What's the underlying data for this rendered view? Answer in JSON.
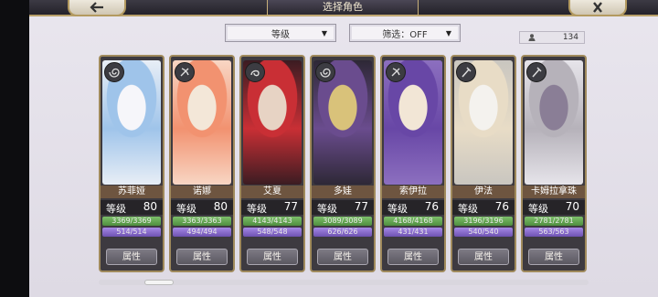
{
  "header": {
    "title": "选择角色",
    "back_icon": "back-arrow-icon",
    "close_icon": "close-icon"
  },
  "filters": {
    "sort_label": "等级",
    "filter_label": "筛选：OFF"
  },
  "counter": {
    "icon": "person-icon",
    "value": "134"
  },
  "level_label": "等级",
  "attr_label": "属性",
  "characters": [
    {
      "name": "苏菲娅",
      "level": "80",
      "hp": "3369/3369",
      "mp": "514/514",
      "hp_pct": 1.0,
      "mp_pct": 1.0,
      "emblem": "spiral-icon",
      "palette": [
        "#e8eef6",
        "#9fc4ea",
        "#f6f6fa"
      ]
    },
    {
      "name": "诺娜",
      "level": "80",
      "hp": "3363/3363",
      "mp": "494/494",
      "hp_pct": 1.0,
      "mp_pct": 1.0,
      "emblem": "bow-icon",
      "palette": [
        "#f8d6c4",
        "#f29270",
        "#f3e7d8"
      ]
    },
    {
      "name": "艾夏",
      "level": "77",
      "hp": "4143/4143",
      "mp": "548/548",
      "hp_pct": 1.0,
      "mp_pct": 1.0,
      "emblem": "swirl-icon",
      "palette": [
        "#3b1c22",
        "#c92f35",
        "#e7d3c4"
      ]
    },
    {
      "name": "多娃",
      "level": "77",
      "hp": "3089/3089",
      "mp": "626/626",
      "hp_pct": 1.0,
      "mp_pct": 1.0,
      "emblem": "spiral-icon",
      "palette": [
        "#2e2836",
        "#6a4c8e",
        "#d9c27a"
      ]
    },
    {
      "name": "索伊拉",
      "level": "76",
      "hp": "4168/4168",
      "mp": "431/431",
      "hp_pct": 1.0,
      "mp_pct": 1.0,
      "emblem": "bow-icon",
      "palette": [
        "#8c6fbf",
        "#6847a6",
        "#f2e6d6"
      ]
    },
    {
      "name": "伊法",
      "level": "76",
      "hp": "3196/3196",
      "mp": "540/540",
      "hp_pct": 1.0,
      "mp_pct": 1.0,
      "emblem": "staff-icon",
      "palette": [
        "#c9c6c0",
        "#e8dcc6",
        "#f4f2ee"
      ]
    },
    {
      "name": "卡姆拉拿珠",
      "level": "70",
      "hp": "2781/2781",
      "mp": "563/563",
      "hp_pct": 1.0,
      "mp_pct": 1.0,
      "emblem": "staff-icon",
      "palette": [
        "#e6e4ea",
        "#b6b2ba",
        "#8a7e96"
      ]
    }
  ],
  "scroll": {
    "position_fraction": 0.1
  }
}
